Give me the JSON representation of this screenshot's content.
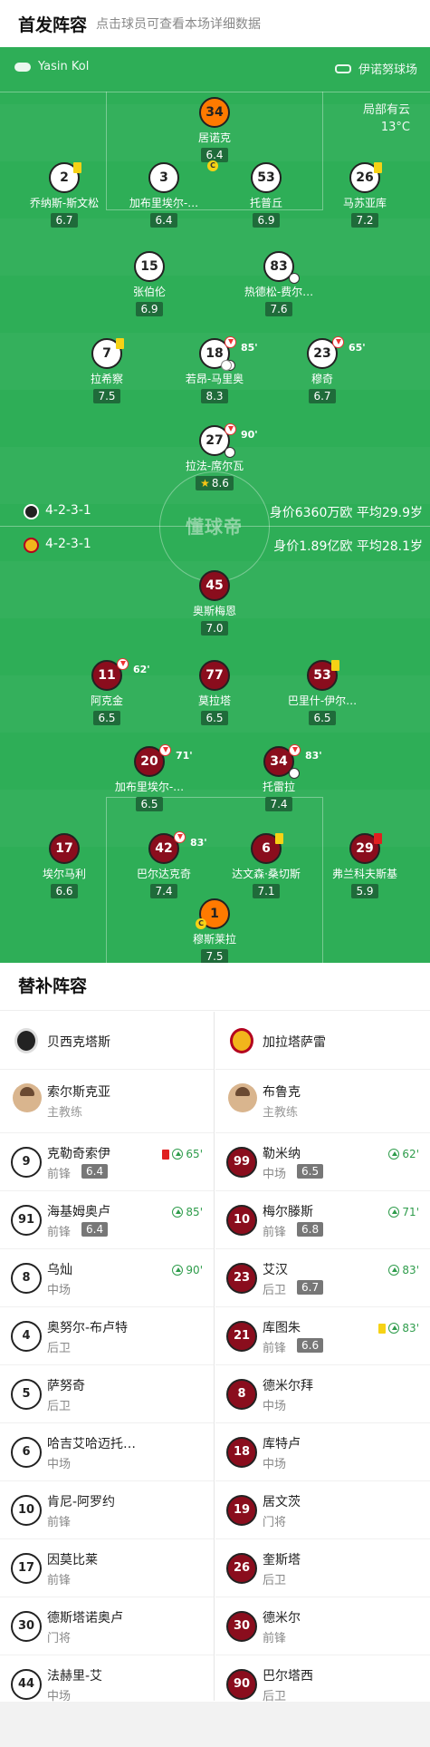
{
  "header": {
    "title": "首发阵容",
    "subtitle": "点击球员可查看本场详细数据"
  },
  "pitch": {
    "referee": "Yasin Kol",
    "stadium": "伊诺努球场",
    "weather": "局部有云",
    "temperature": "13°C",
    "watermark": "懂球帝",
    "home": {
      "formation": "4-2-3-1",
      "value": "身价6360万欧  平均29.9岁"
    },
    "away": {
      "formation": "4-2-3-1",
      "value": "身价1.89亿欧  平均28.1岁"
    }
  },
  "home_players": [
    {
      "num": "34",
      "name": "居诺克",
      "rating": "6.4",
      "gk": true,
      "captain": true
    },
    {
      "num": "2",
      "name": "乔纳斯-斯文松",
      "rating": "6.7",
      "yellow": true
    },
    {
      "num": "3",
      "name": "加布里埃尔-…",
      "rating": "6.4"
    },
    {
      "num": "53",
      "name": "托普丘",
      "rating": "6.9"
    },
    {
      "num": "26",
      "name": "马苏亚库",
      "rating": "7.2",
      "yellow": true
    },
    {
      "num": "15",
      "name": "张伯伦",
      "rating": "6.9"
    },
    {
      "num": "83",
      "name": "热德松-费尔…",
      "rating": "7.6",
      "goal": true
    },
    {
      "num": "7",
      "name": "拉希察",
      "rating": "7.5",
      "yellow": true
    },
    {
      "num": "18",
      "name": "若昂-马里奥",
      "rating": "8.3",
      "sub": "85'",
      "goal": true,
      "assist": true
    },
    {
      "num": "23",
      "name": "穆奇",
      "rating": "6.7",
      "sub": "65'"
    },
    {
      "num": "27",
      "name": "拉法-席尔瓦",
      "rating": "8.6",
      "sub": "90'",
      "goal": true,
      "best": true
    }
  ],
  "away_players": [
    {
      "num": "45",
      "name": "奥斯梅恩",
      "rating": "7.0"
    },
    {
      "num": "11",
      "name": "阿克金",
      "rating": "6.5",
      "sub": "62'"
    },
    {
      "num": "77",
      "name": "莫拉塔",
      "rating": "6.5"
    },
    {
      "num": "53",
      "name": "巴里什-伊尔…",
      "rating": "6.5",
      "yellow": true
    },
    {
      "num": "20",
      "name": "加布里埃尔-…",
      "rating": "6.5",
      "sub": "71'"
    },
    {
      "num": "34",
      "name": "托雷拉",
      "rating": "7.4",
      "sub": "83'",
      "goal": true
    },
    {
      "num": "17",
      "name": "埃尔马利",
      "rating": "6.6"
    },
    {
      "num": "42",
      "name": "巴尔达克奇",
      "rating": "7.4",
      "sub": "83'"
    },
    {
      "num": "6",
      "name": "达文森·桑切斯",
      "rating": "7.1",
      "yellow": true
    },
    {
      "num": "29",
      "name": "弗兰科夫斯基",
      "rating": "5.9",
      "red": true
    },
    {
      "num": "1",
      "name": "穆斯莱拉",
      "rating": "7.5",
      "gk": true,
      "captain": true
    }
  ],
  "subs": {
    "title": "替补阵容",
    "home": {
      "team": "贝西克塔斯",
      "coach": {
        "name": "索尔斯克亚",
        "role": "主教练"
      },
      "players": [
        {
          "num": "9",
          "name": "克勒奇索伊",
          "pos": "前锋",
          "rating": "6.4",
          "card": "red",
          "in": "65'"
        },
        {
          "num": "91",
          "name": "海基姆奥卢",
          "pos": "前锋",
          "rating": "6.4",
          "in": "85'"
        },
        {
          "num": "8",
          "name": "乌灿",
          "pos": "中场",
          "in": "90'"
        },
        {
          "num": "4",
          "name": "奥努尔-布卢特",
          "pos": "后卫"
        },
        {
          "num": "5",
          "name": "萨努奇",
          "pos": "后卫"
        },
        {
          "num": "6",
          "name": "哈吉艾哈迈托…",
          "pos": "中场"
        },
        {
          "num": "10",
          "name": "肯尼-阿罗约",
          "pos": "前锋"
        },
        {
          "num": "17",
          "name": "因莫比莱",
          "pos": "前锋"
        },
        {
          "num": "30",
          "name": "德斯塔诺奥卢",
          "pos": "门将"
        },
        {
          "num": "44",
          "name": "法赫里-艾",
          "pos": "中场"
        }
      ]
    },
    "away": {
      "team": "加拉塔萨雷",
      "coach": {
        "name": "布鲁克",
        "role": "主教练"
      },
      "players": [
        {
          "num": "99",
          "name": "勒米纳",
          "pos": "中场",
          "rating": "6.5",
          "in": "62'"
        },
        {
          "num": "10",
          "name": "梅尔滕斯",
          "pos": "前锋",
          "rating": "6.8",
          "in": "71'"
        },
        {
          "num": "23",
          "name": "艾汉",
          "pos": "后卫",
          "rating": "6.7",
          "in": "83'"
        },
        {
          "num": "21",
          "name": "库图朱",
          "pos": "前锋",
          "rating": "6.6",
          "card": "yellow",
          "in": "83'"
        },
        {
          "num": "8",
          "name": "德米尔拜",
          "pos": "中场"
        },
        {
          "num": "18",
          "name": "库特卢",
          "pos": "中场"
        },
        {
          "num": "19",
          "name": "居文茨",
          "pos": "门将"
        },
        {
          "num": "26",
          "name": "奎斯塔",
          "pos": "后卫"
        },
        {
          "num": "30",
          "name": "德米尔",
          "pos": "前锋"
        },
        {
          "num": "90",
          "name": "巴尔塔西",
          "pos": "后卫"
        }
      ]
    }
  },
  "colors": {
    "pitch": "#2eae57",
    "home_kit": "#ffffff",
    "away_kit": "#8a0d1d",
    "gk_kit": "#ff7a00"
  }
}
